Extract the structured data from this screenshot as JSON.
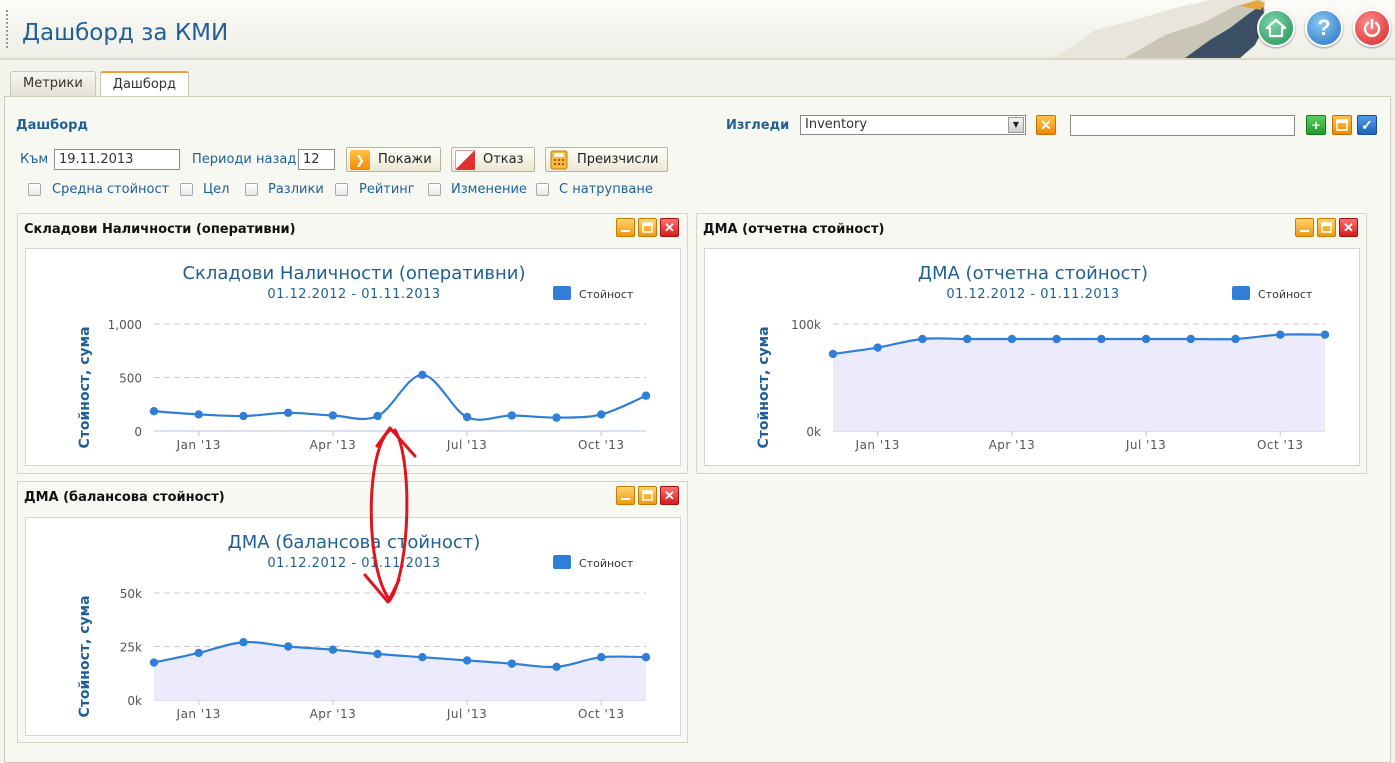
{
  "app": {
    "title": "Дашборд за КМИ",
    "help_glyph": "?"
  },
  "tabs": [
    {
      "label": "Метрики",
      "active": false
    },
    {
      "label": "Дашборд",
      "active": true
    }
  ],
  "toolbar": {
    "dashboard_label": "Дашборд",
    "views_label": "Изгледи",
    "views_selected": "Inventory",
    "view_name_value": "",
    "to_label": "Към",
    "to_value": "19.11.2013",
    "periods_label": "Периоди назад",
    "periods_value": "12",
    "show_button": "Покажи",
    "cancel_button": "Отказ",
    "recalc_button": "Преизчисли",
    "checkboxes": [
      "Средна стойност",
      "Цел",
      "Разлики",
      "Рейтинг",
      "Изменение",
      "С натрупване"
    ]
  },
  "panels": [
    {
      "title": "Складови Наличности (оперативни)"
    },
    {
      "title": "ДМА (отчетна стойност)"
    },
    {
      "title": "ДМА (балансова стойност)"
    }
  ],
  "colors": {
    "accent": "#1f5f96",
    "series": "#2f7ed8",
    "area": "#ebebfb",
    "annotation": "#e0141e"
  },
  "chart_data": [
    {
      "type": "line",
      "title": "Складови Наличности (оперативни)",
      "subtitle": "01.12.2012 - 01.11.2013",
      "ylabel": "Стойност, сума",
      "ylim": [
        0,
        1000
      ],
      "yticks": [
        "0",
        "500",
        "1,000"
      ],
      "xtick_labels": [
        "Jan '13",
        "Apr '13",
        "Jul '13",
        "Oct '13"
      ],
      "legend": "top-right",
      "x": [
        "2012-12",
        "2013-01",
        "2013-02",
        "2013-03",
        "2013-04",
        "2013-05",
        "2013-06",
        "2013-07",
        "2013-08",
        "2013-09",
        "2013-10",
        "2013-11"
      ],
      "series": [
        {
          "name": "Стойност",
          "values": [
            185,
            155,
            140,
            170,
            145,
            140,
            525,
            130,
            145,
            125,
            155,
            330
          ]
        }
      ],
      "area": false
    },
    {
      "type": "area",
      "title": "ДМА (отчетна стойност)",
      "subtitle": "01.12.2012 - 01.11.2013",
      "ylabel": "Стойност, сума",
      "ylim": [
        0,
        100000
      ],
      "yticks": [
        "0k",
        "100k"
      ],
      "xtick_labels": [
        "Jan '13",
        "Apr '13",
        "Jul '13",
        "Oct '13"
      ],
      "legend": "top-right",
      "x": [
        "2012-12",
        "2013-01",
        "2013-02",
        "2013-03",
        "2013-04",
        "2013-05",
        "2013-06",
        "2013-07",
        "2013-08",
        "2013-09",
        "2013-10",
        "2013-11"
      ],
      "series": [
        {
          "name": "Стойност",
          "values": [
            72000,
            78000,
            86000,
            86000,
            86000,
            86000,
            86000,
            86000,
            86000,
            86000,
            90000,
            90000
          ]
        }
      ],
      "area": true
    },
    {
      "type": "area",
      "title": "ДМА (балансова стойност)",
      "subtitle": "01.12.2012 - 01.11.2013",
      "ylabel": "Стойност, сума",
      "ylim": [
        0,
        50000
      ],
      "yticks": [
        "0k",
        "25k",
        "50k"
      ],
      "xtick_labels": [
        "Jan '13",
        "Apr '13",
        "Jul '13",
        "Oct '13"
      ],
      "legend": "top-right",
      "x": [
        "2012-12",
        "2013-01",
        "2013-02",
        "2013-03",
        "2013-04",
        "2013-05",
        "2013-06",
        "2013-07",
        "2013-08",
        "2013-09",
        "2013-10",
        "2013-11"
      ],
      "series": [
        {
          "name": "Стойност",
          "values": [
            17500,
            22000,
            27000,
            25000,
            23500,
            21500,
            20000,
            18500,
            17000,
            15500,
            20000,
            20000
          ]
        }
      ],
      "area": true
    }
  ]
}
